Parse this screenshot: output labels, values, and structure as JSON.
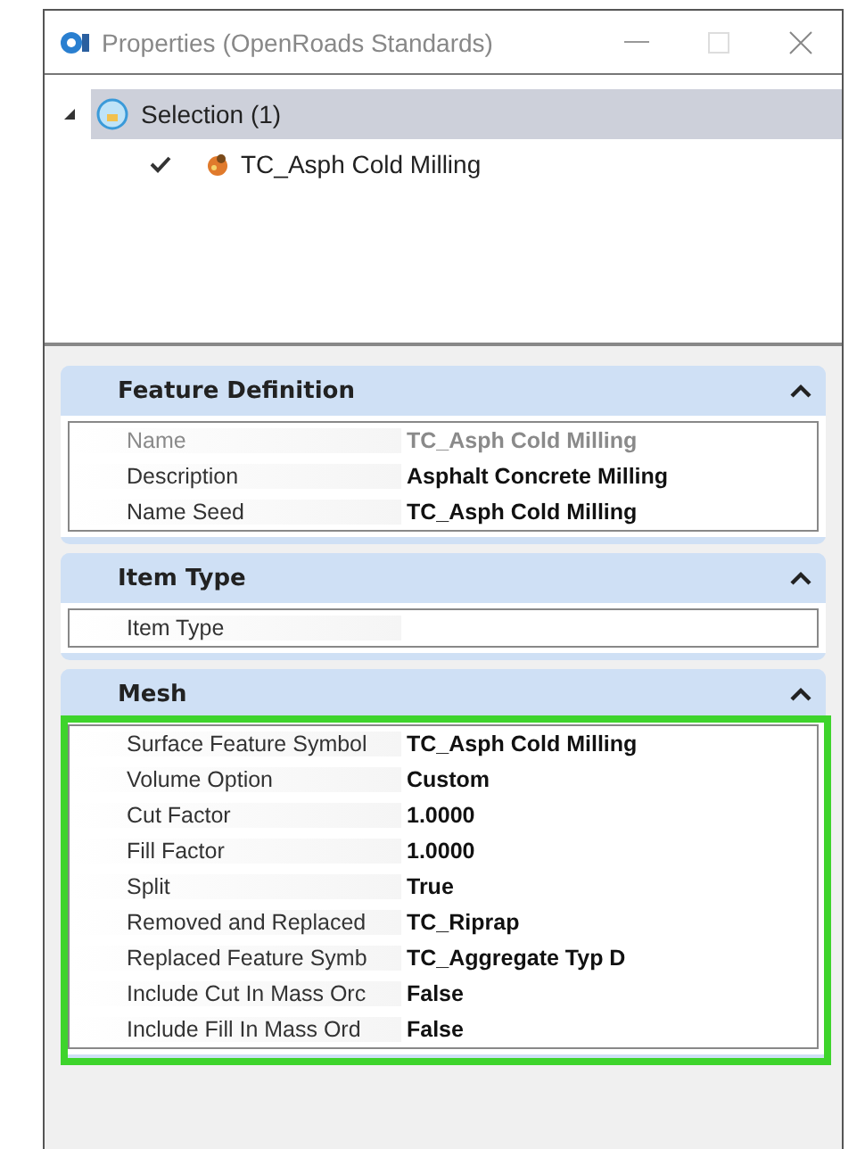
{
  "window": {
    "title": "Properties (OpenRoads Standards)"
  },
  "tree": {
    "label": "Selection (1)",
    "expanded": true,
    "selected": true,
    "children": [
      {
        "label": "TC_Asph Cold Milling",
        "checked": true
      }
    ]
  },
  "sections": [
    {
      "title": "Feature Definition",
      "expanded": true,
      "highlighted": false,
      "rows": [
        {
          "label": "Name",
          "value": "TC_Asph Cold Milling",
          "disabled": true
        },
        {
          "label": "Description",
          "value": "Asphalt Concrete Milling",
          "disabled": false
        },
        {
          "label": "Name Seed",
          "value": "TC_Asph Cold Milling",
          "disabled": false
        }
      ]
    },
    {
      "title": "Item Type",
      "expanded": true,
      "highlighted": false,
      "rows": [
        {
          "label": "Item Type",
          "disabled": false
        }
      ]
    },
    {
      "title": "Mesh",
      "expanded": true,
      "highlighted": true,
      "rows": [
        {
          "label": "Surface Feature Symbol",
          "value": "TC_Asph Cold Milling",
          "disabled": false
        },
        {
          "label": "Volume Option",
          "value": "Custom",
          "disabled": false
        },
        {
          "label": "Cut Factor",
          "value": "1.0000",
          "disabled": false
        },
        {
          "label": "Fill Factor",
          "value": "1.0000",
          "disabled": false
        },
        {
          "label": "Split",
          "value": "True",
          "disabled": false
        },
        {
          "label": "Removed and Replaced",
          "value": "TC_Riprap",
          "disabled": false
        },
        {
          "label": "Replaced Feature Symb",
          "value": "TC_Aggregate Typ D",
          "disabled": false
        },
        {
          "label": "Include Cut In Mass Orc",
          "value": "False",
          "disabled": false
        },
        {
          "label": "Include Fill In Mass Ord",
          "value": "False",
          "disabled": false
        }
      ]
    }
  ]
}
